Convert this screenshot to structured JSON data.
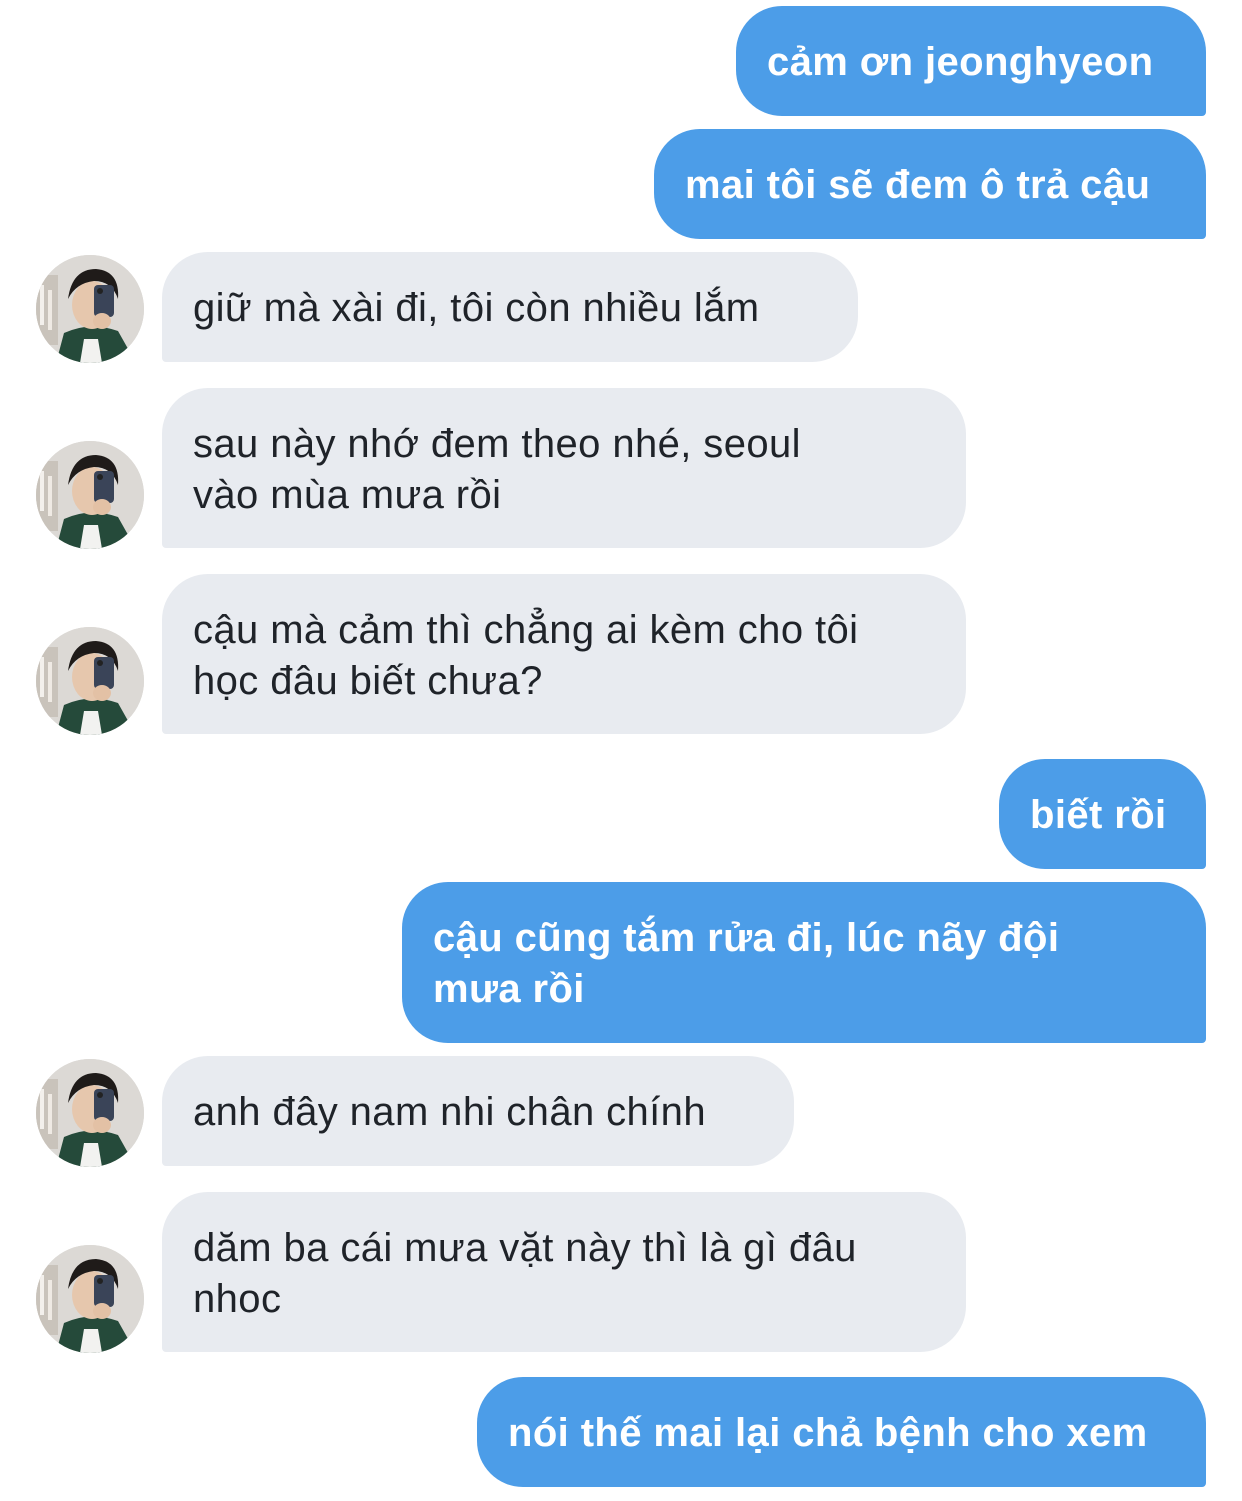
{
  "conversation": {
    "messages": [
      {
        "side": "sent",
        "text": "cảm ơn jeonghyeon"
      },
      {
        "side": "sent",
        "text": "mai tôi sẽ đem ô trả cậu"
      },
      {
        "side": "received",
        "text": "giữ mà xài đi, tôi còn nhiều lắm"
      },
      {
        "side": "received",
        "text": "sau này nhớ đem theo nhé, seoul\nvào mùa mưa rồi"
      },
      {
        "side": "received",
        "text": "cậu mà cảm thì chẳng ai kèm cho tôi\nhọc đâu biết chưa?"
      },
      {
        "side": "sent",
        "text": "biết rồi"
      },
      {
        "side": "sent",
        "text": "cậu cũng tắm rửa đi, lúc nãy đội\nmưa rồi"
      },
      {
        "side": "received",
        "text": "anh đây nam nhi chân chính"
      },
      {
        "side": "received",
        "text": "dăm ba cái mưa vặt này thì là gì đâu\nnhoc"
      },
      {
        "side": "sent",
        "text": "nói thế mai lại chả bệnh cho xem"
      }
    ]
  },
  "colors": {
    "sent_bubble": "#4c9de8",
    "received_bubble": "#e8ebf0",
    "sent_text": "#ffffff",
    "received_text": "#1f2329",
    "background": "#ffffff"
  },
  "icons": {
    "contact_avatar": "contact-avatar-photo"
  }
}
